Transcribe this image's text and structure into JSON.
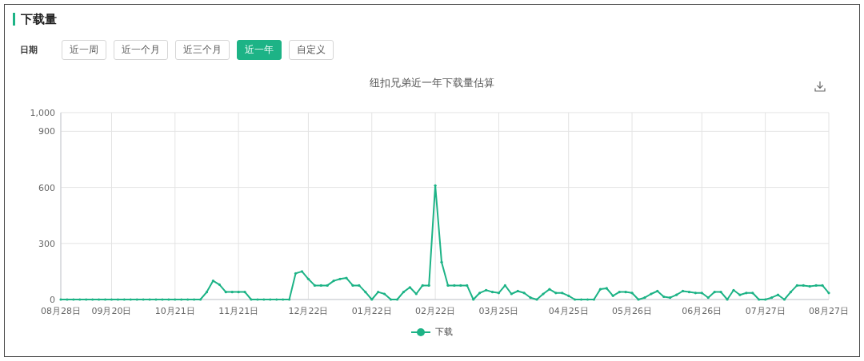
{
  "section": {
    "title": "下载量"
  },
  "date_filter": {
    "label": "日期",
    "options": [
      {
        "label": "近一周",
        "selected": false
      },
      {
        "label": "近一个月",
        "selected": false
      },
      {
        "label": "近三个月",
        "selected": false
      },
      {
        "label": "近一年",
        "selected": true
      },
      {
        "label": "自定义",
        "selected": false
      }
    ]
  },
  "chart": {
    "chart_data": {
      "type": "line",
      "title": "纽扣兄弟近一年下载量估算",
      "categories": [
        "08月28日",
        null,
        null,
        null,
        null,
        null,
        null,
        null,
        "09月20日",
        null,
        null,
        null,
        null,
        null,
        null,
        null,
        null,
        null,
        "10月21日",
        null,
        null,
        null,
        null,
        null,
        null,
        null,
        null,
        null,
        "11月21日",
        null,
        null,
        null,
        null,
        null,
        null,
        null,
        null,
        null,
        null,
        "12月22日",
        null,
        null,
        null,
        null,
        null,
        null,
        null,
        null,
        null,
        "01月22日",
        null,
        null,
        null,
        null,
        null,
        null,
        null,
        null,
        null,
        "02月22日",
        null,
        null,
        null,
        null,
        null,
        null,
        null,
        null,
        null,
        "03月25日",
        null,
        null,
        null,
        null,
        null,
        null,
        null,
        null,
        null,
        null,
        "04月25日",
        null,
        null,
        null,
        null,
        null,
        null,
        null,
        null,
        null,
        "05月26日",
        null,
        null,
        null,
        null,
        null,
        null,
        null,
        null,
        null,
        null,
        "06月26日",
        null,
        null,
        null,
        null,
        null,
        null,
        null,
        null,
        null,
        "07月27日",
        null,
        null,
        null,
        null,
        null,
        null,
        null,
        null,
        null,
        "08月27日"
      ],
      "series": [
        {
          "name": "下载",
          "color": "#1db386",
          "values": [
            0,
            0,
            0,
            0,
            0,
            0,
            0,
            0,
            0,
            0,
            0,
            0,
            0,
            0,
            0,
            0,
            0,
            0,
            0,
            0,
            0,
            0,
            0,
            40,
            100,
            80,
            40,
            40,
            40,
            40,
            0,
            0,
            0,
            0,
            0,
            0,
            0,
            140,
            150,
            110,
            75,
            75,
            75,
            100,
            110,
            115,
            75,
            75,
            40,
            0,
            40,
            30,
            0,
            0,
            40,
            65,
            30,
            75,
            75,
            610,
            200,
            75,
            75,
            75,
            75,
            0,
            35,
            50,
            40,
            35,
            75,
            30,
            45,
            35,
            10,
            0,
            30,
            55,
            35,
            35,
            20,
            0,
            0,
            0,
            0,
            55,
            60,
            20,
            40,
            40,
            35,
            0,
            10,
            30,
            45,
            15,
            10,
            25,
            45,
            40,
            35,
            35,
            10,
            40,
            40,
            0,
            50,
            25,
            35,
            35,
            0,
            0,
            10,
            25,
            0,
            40,
            75,
            75,
            70,
            75,
            75,
            35
          ]
        }
      ],
      "ylim": [
        0,
        1000
      ],
      "grid": true,
      "yticks": [
        0,
        300,
        600,
        900,
        {
          "value": 1000,
          "label": "1,000"
        }
      ]
    }
  }
}
